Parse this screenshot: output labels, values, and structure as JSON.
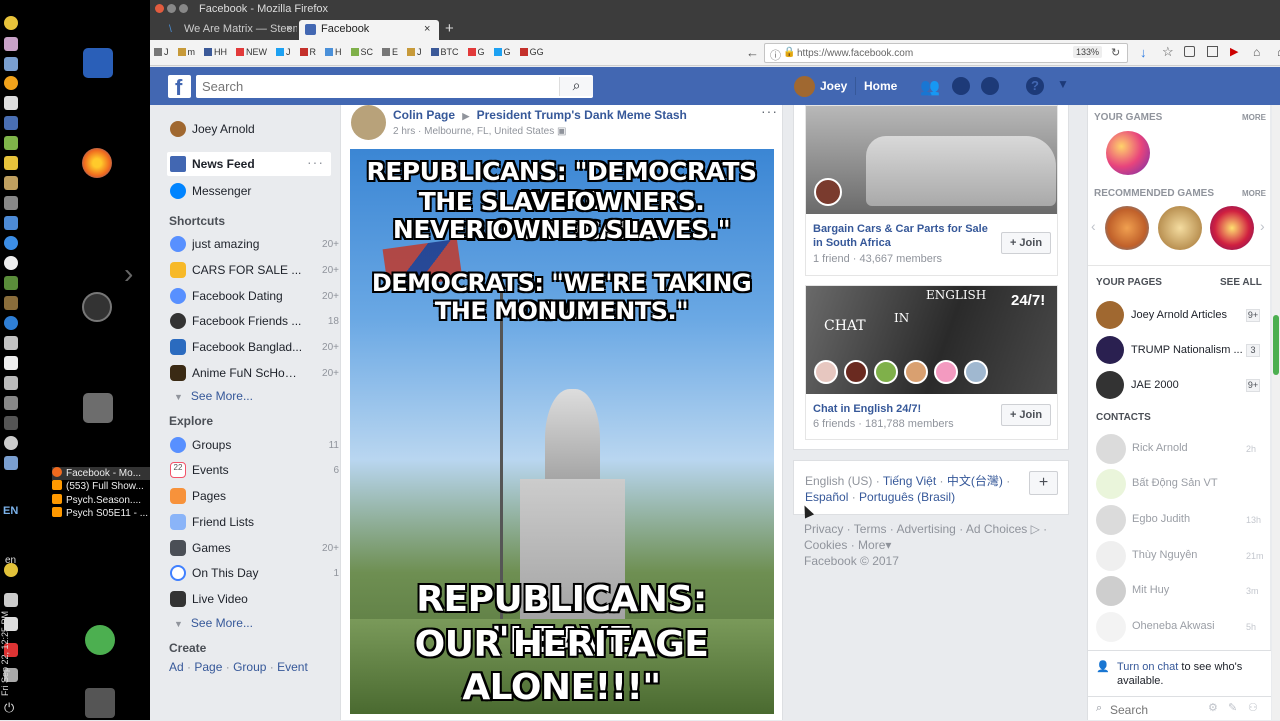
{
  "desktop": {
    "language": "EN",
    "lang_lower": "en",
    "clock": "Fri Sep 22, 12:25 PM",
    "tasks": [
      "Facebook - Mo...",
      "(553) Full Show...",
      "Psych.Season....",
      "Psych S05E11 - ..."
    ]
  },
  "window": {
    "title": "Facebook - Mozilla Firefox",
    "tabs": [
      {
        "label": "We Are Matrix — Steem"
      },
      {
        "label": "Facebook"
      }
    ],
    "url": "https://www.facebook.com",
    "zoom": "133%"
  },
  "bookmarks": [
    "J",
    "m",
    "HH",
    "NEW",
    "J",
    "R",
    "H",
    "SC",
    "E",
    "J",
    "BTC",
    "G",
    "G",
    "GG"
  ],
  "fbnav": {
    "search_placeholder": "Search",
    "user": "Joey",
    "home": "Home"
  },
  "leftnav": {
    "profile": "Joey Arnold",
    "main": [
      {
        "label": "News Feed"
      },
      {
        "label": "Messenger"
      }
    ],
    "shortcuts_heading": "Shortcuts",
    "shortcuts": [
      {
        "label": "just amazing",
        "count": "20+"
      },
      {
        "label": "CARS FOR SALE ...",
        "count": "20+"
      },
      {
        "label": "Facebook Dating",
        "count": "20+"
      },
      {
        "label": "Facebook Friends ...",
        "count": "18"
      },
      {
        "label": "Facebook Banglad...",
        "count": "20+"
      },
      {
        "label": "Anime FuN ScHoO...",
        "count": "20+"
      }
    ],
    "see_more": "See More...",
    "explore_heading": "Explore",
    "explore": [
      {
        "label": "Groups",
        "count": "11"
      },
      {
        "label": "Events",
        "count": "6"
      },
      {
        "label": "Pages",
        "count": ""
      },
      {
        "label": "Friend Lists",
        "count": ""
      },
      {
        "label": "Games",
        "count": "20+"
      },
      {
        "label": "On This Day",
        "count": "1"
      },
      {
        "label": "Live Video",
        "count": ""
      }
    ],
    "see_more2": "See More...",
    "create_heading": "Create",
    "create": [
      "Ad",
      "Page",
      "Group",
      "Event"
    ]
  },
  "post": {
    "author": "Colin Page",
    "target": "President Trump's Dank Meme Stash",
    "time": "2 hrs",
    "location": "Melbourne, FL, United States",
    "meme_lines": [
      "REPUBLICANS: \"DEMOCRATS WERE",
      "THE SLAVE OWNERS. REPUBLICANS",
      "NEVER OWNED SLAVES.\"",
      "DEMOCRATS: \"WE'RE TAKING DOWN",
      "THE MONUMENTS.\"",
      "REPUBLICANS: \"LEAVE",
      "OUR HERITAGE",
      "ALONE!!!\""
    ]
  },
  "groups": [
    {
      "name": "Bargain Cars & Car Parts for Sale in South Africa",
      "stats": "1 friend · 43,667 members",
      "join": "Join"
    },
    {
      "name": "Chat in English 24/7!",
      "stats": "6 friends · 181,788 members",
      "join": "Join",
      "banner_left": "CHAT",
      "banner_in": "IN",
      "banner_right": "ENGLISH",
      "banner_hours": "24/7!"
    }
  ],
  "footer": {
    "lang_current": "English (US)",
    "langs": [
      "Tiếng Việt",
      "中文(台灣)",
      "Español",
      "Português (Brasil)"
    ],
    "links": [
      "Privacy",
      "Terms",
      "Advertising",
      "Ad Choices",
      "Cookies",
      "More"
    ],
    "copyright": "Facebook © 2017"
  },
  "chat": {
    "your_games": "YOUR GAMES",
    "more": "MORE",
    "recommended_games": "RECOMMENDED GAMES",
    "more2": "MORE",
    "your_pages": "YOUR PAGES",
    "see_all": "SEE ALL",
    "pages": [
      {
        "name": "Joey Arnold Articles",
        "count": "9+"
      },
      {
        "name": "TRUMP Nationalism ...",
        "count": "3"
      },
      {
        "name": "JAE 2000",
        "count": "9+"
      }
    ],
    "contacts_heading": "CONTACTS",
    "contacts": [
      {
        "name": "Rick Arnold",
        "time": "2h"
      },
      {
        "name": "Bất Động Sản VT",
        "time": ""
      },
      {
        "name": "Egbo Judith",
        "time": "13h"
      },
      {
        "name": "Thùy Nguyễn",
        "time": "21m"
      },
      {
        "name": "Mit Huy",
        "time": "3m"
      },
      {
        "name": "Oheneba Akwasi",
        "time": "5h"
      }
    ],
    "turn_on": "Turn on chat",
    "turn_on_rest": "to see who's available.",
    "search_placeholder": "Search"
  },
  "colors": {
    "fb_blue": "#4267b2",
    "link": "#365899",
    "bg": "#e9ebee"
  }
}
